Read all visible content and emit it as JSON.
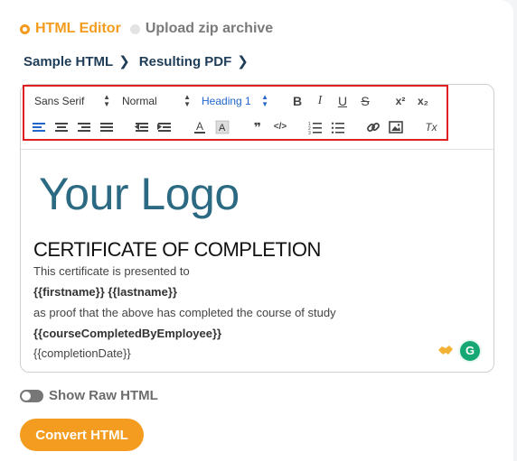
{
  "source_mode": {
    "options": [
      {
        "label": "HTML Editor",
        "selected": true
      },
      {
        "label": "Upload zip archive",
        "selected": false
      }
    ]
  },
  "tabs": [
    {
      "label": "Sample HTML"
    },
    {
      "label": "Resulting PDF"
    }
  ],
  "toolbar": {
    "font_family": "Sans Serif",
    "font_size": "Normal",
    "heading": "Heading 1",
    "bold_label": "B",
    "italic_label": "I",
    "underline_label": "U",
    "strike_label": "S",
    "superscript_label": "x²",
    "subscript_label": "x₂",
    "blockquote_label": "❞",
    "code_label": "</>",
    "clear_format_label": "Tx"
  },
  "document": {
    "logo_text": "Your Logo",
    "title": "CERTIFICATE OF COMPLETION",
    "lines": [
      {
        "text": "This certificate is presented to",
        "bold": false
      },
      {
        "text": "{{firstname}} {{lastname}}",
        "bold": true
      },
      {
        "text": "as proof that the above has completed the course of study",
        "bold": false
      },
      {
        "text": "{{courseCompletedByEmployee}}",
        "bold": true
      },
      {
        "text": "{{completionDate}}",
        "bold": false
      }
    ]
  },
  "grammarly_label": "G",
  "raw_html_toggle": {
    "label": "Show Raw HTML",
    "on": false
  },
  "convert_button": {
    "label": "Convert HTML"
  },
  "colors": {
    "accent": "#f39c1f",
    "nav": "#1f3d58",
    "logo": "#2b6a82",
    "toolbar_active": "#2266cc",
    "highlight_box": "#e02020",
    "grammarly": "#15a874"
  }
}
